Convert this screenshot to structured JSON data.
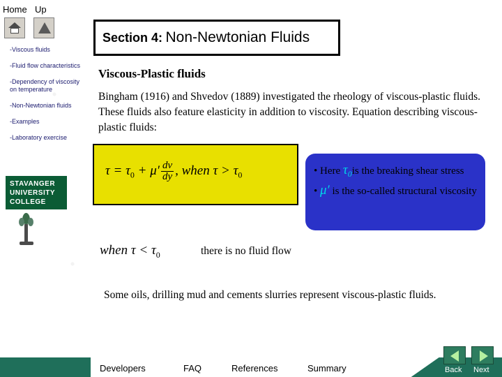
{
  "nav": {
    "home_label": "Home",
    "up_label": "Up",
    "home_icon": "house-icon",
    "up_icon": "triangle-up-icon"
  },
  "sidebar": {
    "items": [
      "-Viscous fluids",
      "-Fluid flow characteristics",
      "-Dependency of viscosity on temperature",
      "-Non-Newtonian fluids",
      "-Examples",
      "-Laboratory exercise"
    ],
    "logo": {
      "line1": "STAVANGER",
      "line2": "UNIVERSITY",
      "line3": "COLLEGE",
      "emblem": "torch-icon"
    }
  },
  "title": {
    "section": "Section 4:",
    "name": "Non-Newtonian Fluids"
  },
  "content": {
    "heading": "Viscous-Plastic fluids",
    "paragraph": "Bingham (1916) and Shvedov (1889) investigated the rheology of viscous-plastic fluids. These fluids also feature elasticity in addition to viscosity. Equation describing viscous-plastic fluids:",
    "equation_main": {
      "lhs": "τ = τ",
      "lhs_sub": "0",
      "plus": " + μ′",
      "frac_num": "dv",
      "frac_den": "dy",
      "when": ", when τ >  τ",
      "when_sub": "0"
    },
    "callout": {
      "bullet1_pre": "• Here ",
      "bullet1_sym": "τ",
      "bullet1_sub": "0",
      "bullet1_post": "is the breaking shear stress",
      "bullet2_pre": "• ",
      "bullet2_sym": "μ′",
      "bullet2_post": " is the so-called structural viscosity",
      "color": "#2a32c8",
      "symbol_color": "#00d4e8"
    },
    "equation_second": {
      "text": "when τ <  τ",
      "sub": "0"
    },
    "equation_second_tail": "there is no fluid flow",
    "paragraph2": "Some oils, drilling mud and cements slurries represent viscous-plastic fluids."
  },
  "footer": {
    "links": [
      "Developers",
      "FAQ",
      "References",
      "Summary"
    ],
    "back_label": "Back",
    "next_label": "Next",
    "back_icon": "arrow-left-icon",
    "next_icon": "arrow-right-icon",
    "bar_color": "#1f6f5a"
  }
}
